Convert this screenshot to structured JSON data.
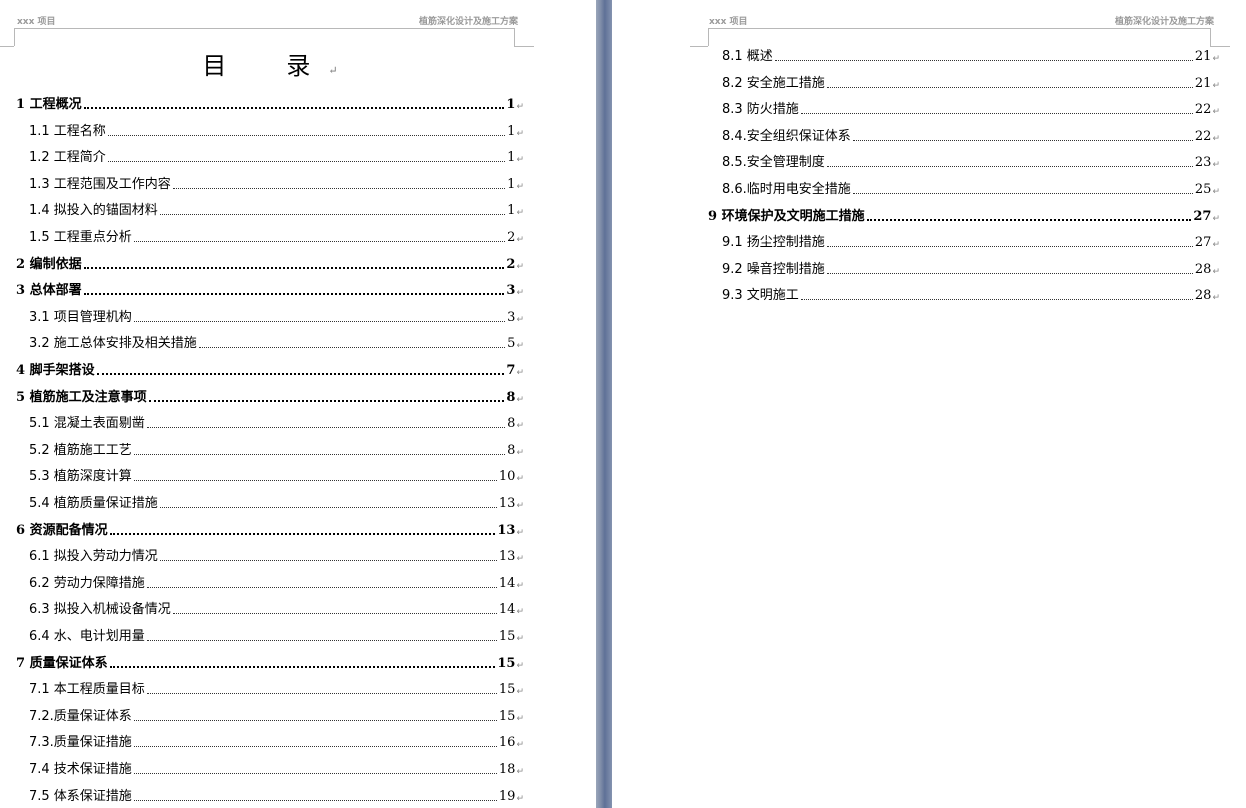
{
  "left_page": {
    "header_left": "xxx 项目",
    "header_right": "植筋深化设计及施工方案",
    "title": "目　录",
    "entries": [
      {
        "label": "1 工程概况",
        "page": "1"
      },
      {
        "label": "1.1 工程名称",
        "page": "1"
      },
      {
        "label": "1.2 工程简介",
        "page": "1"
      },
      {
        "label": "1.3 工程范围及工作内容",
        "page": "1"
      },
      {
        "label": "1.4 拟投入的锚固材料",
        "page": "1"
      },
      {
        "label": "1.5 工程重点分析",
        "page": "2"
      },
      {
        "label": "2 编制依据",
        "page": "2"
      },
      {
        "label": "3 总体部署",
        "page": "3"
      },
      {
        "label": "3.1 项目管理机构",
        "page": "3"
      },
      {
        "label": "3.2 施工总体安排及相关措施",
        "page": "5"
      },
      {
        "label": "4 脚手架搭设",
        "page": "7"
      },
      {
        "label": "5 植筋施工及注意事项",
        "page": "8"
      },
      {
        "label": "5.1 混凝土表面剔凿",
        "page": "8"
      },
      {
        "label": "5.2 植筋施工工艺",
        "page": "8"
      },
      {
        "label": "5.3 植筋深度计算",
        "page": "10"
      },
      {
        "label": "5.4 植筋质量保证措施",
        "page": "13"
      },
      {
        "label": "6 资源配备情况",
        "page": "13"
      },
      {
        "label": "6.1 拟投入劳动力情况",
        "page": "13"
      },
      {
        "label": "6.2 劳动力保障措施",
        "page": "14"
      },
      {
        "label": "6.3 拟投入机械设备情况",
        "page": "14"
      },
      {
        "label": "6.4 水、电计划用量",
        "page": "15"
      },
      {
        "label": "7 质量保证体系",
        "page": "15"
      },
      {
        "label": "7.1 本工程质量目标",
        "page": "15"
      },
      {
        "label": "7.2.质量保证体系",
        "page": "15"
      },
      {
        "label": "7.3.质量保证措施",
        "page": "16"
      },
      {
        "label": "7.4 技术保证措施",
        "page": "18"
      },
      {
        "label": "7.5 体系保证措施",
        "page": "19"
      }
    ]
  },
  "right_page": {
    "header_left": "xxx 项目",
    "header_right": "植筋深化设计及施工方案",
    "entries": [
      {
        "label": "8.1 概述",
        "page": "21"
      },
      {
        "label": "8.2 安全施工措施",
        "page": "21"
      },
      {
        "label": "8.3 防火措施",
        "page": "22"
      },
      {
        "label": "8.4.安全组织保证体系",
        "page": "22"
      },
      {
        "label": "8.5.安全管理制度",
        "page": "23"
      },
      {
        "label": "8.6.临时用电安全措施",
        "page": "25"
      },
      {
        "label": "9 环境保护及文明施工措施",
        "page": "27"
      },
      {
        "label": "9.1 扬尘控制措施",
        "page": "27"
      },
      {
        "label": "9.2 噪音控制措施",
        "page": "28"
      },
      {
        "label": "9.3 文明施工",
        "page": "28"
      }
    ]
  }
}
